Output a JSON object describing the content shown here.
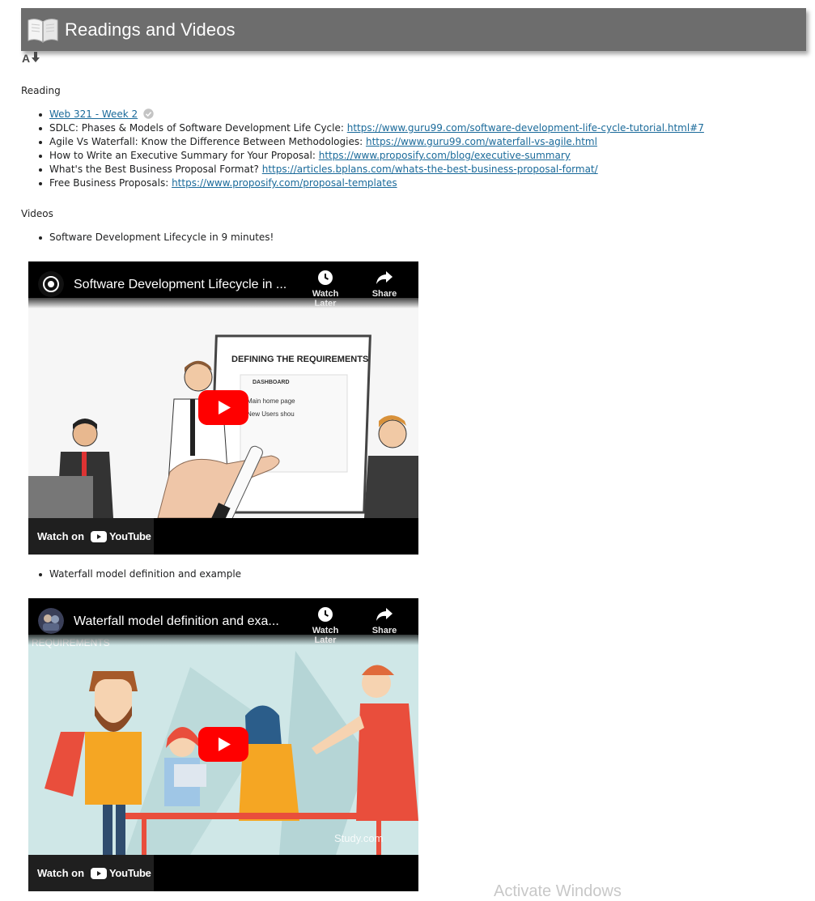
{
  "header": {
    "title": "Readings and Videos",
    "icon": "open-book-icon"
  },
  "sort_icon": "sort-az-icon",
  "reading": {
    "label": "Reading",
    "items": [
      {
        "text": "",
        "link": "Web 321 - Week 2",
        "icon": "check-circle-icon"
      },
      {
        "text": "SDLC: Phases & Models of Software Development Life Cycle: ",
        "link": "https://www.guru99.com/software-development-life-cycle-tutorial.html#7"
      },
      {
        "text": "Agile Vs Waterfall: Know the Difference Between Methodologies: ",
        "link": "https://www.guru99.com/waterfall-vs-agile.html"
      },
      {
        "text": "How to Write an Executive Summary for Your Proposal: ",
        "link": "https://www.proposify.com/blog/executive-summary"
      },
      {
        "text": "What's the Best Business Proposal Format? ",
        "link": "https://articles.bplans.com/whats-the-best-business-proposal-format/"
      },
      {
        "text": "Free Business Proposals: ",
        "link": "https://www.proposify.com/proposal-templates"
      }
    ]
  },
  "videos": {
    "label": "Videos",
    "items": [
      {
        "caption": "Software Development Lifecycle in 9 minutes!",
        "player_title": "Software Development Lifecycle in ...",
        "watch_later": "Watch Later",
        "share": "Share",
        "watch_on": "Watch on",
        "youtube": "YouTube",
        "scene_text": [
          "DEFINING THE REQUIREMENTS",
          "DASHBOARD",
          "Main home page",
          "New Users shou"
        ]
      },
      {
        "caption": "Waterfall model definition and example",
        "player_title": "Waterfall model definition and exa...",
        "watch_later": "Watch Later",
        "share": "Share",
        "watch_on": "Watch on",
        "youtube": "YouTube",
        "scene_text": [
          "REQUIREMENTS",
          "Study.com"
        ]
      }
    ]
  },
  "watermark": "Activate Windows",
  "colors": {
    "header_bg": "#6d6d6d",
    "link": "#1a6a9a",
    "youtube_red": "#ff0000"
  }
}
